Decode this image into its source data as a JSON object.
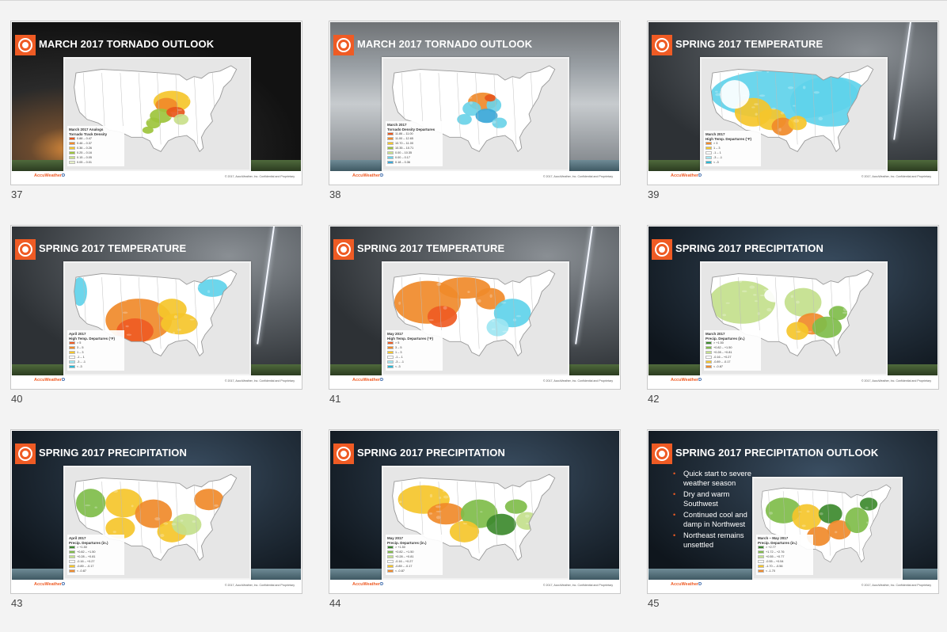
{
  "brand": {
    "name": "AccuWeather",
    "suffix": "D"
  },
  "slides": [
    {
      "number": "37",
      "title": "MARCH 2017 TORNADO OUTLOOK",
      "bg": "storm1",
      "sea": false,
      "mapStyle": "tornado-analog",
      "legend": {
        "title_lines": [
          "March 2017 Analogs",
          "Tornado Track Density"
        ],
        "rows": [
          [
            "#e8561b",
            "0.88 – 0.47"
          ],
          [
            "#f08a2a",
            "0.46 – 0.37"
          ],
          [
            "#f5c62b",
            "0.36 – 0.26"
          ],
          [
            "#9dc43c",
            "0.25 – 0.16"
          ],
          [
            "#c9df8a",
            "0.15 – 0.05"
          ],
          [
            "#e7f0c8",
            "0.05 – 0.01"
          ]
        ]
      },
      "copyright": "© 2017, AccuWeather, Inc. Confidential and Proprietary"
    },
    {
      "number": "38",
      "title": "MARCH 2017 TORNADO OUTLOOK",
      "bg": "storm2",
      "sea": true,
      "mapStyle": "tornado-departure",
      "legend": {
        "title_lines": [
          "March 2017",
          "Tornado Density Departures"
        ],
        "rows": [
          [
            "#e8561b",
            "11.86 – 11.00"
          ],
          [
            "#f08a2a",
            "11.00 – 12.65"
          ],
          [
            "#f5c62b",
            "10.70 – 11.00"
          ],
          [
            "#9dc43c",
            "10.35 – 10.71"
          ],
          [
            "#c9df8a",
            "0.00 – 10.35"
          ],
          [
            "#6ad2e8",
            "0.00 – 0.17"
          ],
          [
            "#3aa7d8",
            "0.18 – 0.36"
          ]
        ]
      },
      "copyright": "© 2017, AccuWeather, Inc. Confidential and Proprietary"
    },
    {
      "number": "39",
      "title": "SPRING 2017 TEMPERATURE",
      "bg": "storm3",
      "sea": false,
      "mapStyle": "temp-march",
      "legend": {
        "title_lines": [
          "March 2017",
          "High Temp. Departures (°F)"
        ],
        "rows": [
          [
            "#f08a2a",
            "> 3"
          ],
          [
            "#f5c62b",
            "1 – 3"
          ],
          [
            "#ffffff",
            "-1 – 1"
          ],
          [
            "#9ee6f2",
            "-3 – -1"
          ],
          [
            "#2bb7d4",
            "< -3"
          ]
        ]
      },
      "copyright": "© 2017, AccuWeather, Inc. Confidential and Proprietary"
    },
    {
      "number": "40",
      "title": "SPRING 2017 TEMPERATURE",
      "bg": "storm3",
      "sea": false,
      "mapStyle": "temp-april",
      "legend": {
        "title_lines": [
          "April 2017",
          "High Temp. Departures (°F)"
        ],
        "rows": [
          [
            "#ef5b24",
            "> 5"
          ],
          [
            "#f08a2a",
            "3 – 5"
          ],
          [
            "#f5c62b",
            "1 – 3"
          ],
          [
            "#ffffff",
            "-1 – 1"
          ],
          [
            "#9ee6f2",
            "-3 – -1"
          ],
          [
            "#2bb7d4",
            "< -3"
          ]
        ]
      },
      "copyright": "© 2017, AccuWeather, Inc. Confidential and Proprietary"
    },
    {
      "number": "41",
      "title": "SPRING 2017 TEMPERATURE",
      "bg": "storm3",
      "sea": false,
      "mapStyle": "temp-may",
      "legend": {
        "title_lines": [
          "May 2017",
          "High Temp. Departures (°F)"
        ],
        "rows": [
          [
            "#ef5b24",
            "> 5"
          ],
          [
            "#f08a2a",
            "3 – 5"
          ],
          [
            "#f5c62b",
            "1 – 3"
          ],
          [
            "#ffffff",
            "-1 – 1"
          ],
          [
            "#9ee6f2",
            "-3 – -1"
          ],
          [
            "#2bb7d4",
            "< -3"
          ]
        ]
      },
      "copyright": "© 2017, AccuWeather, Inc. Confidential and Proprietary"
    },
    {
      "number": "42",
      "title": "SPRING 2017 PRECIPITATION",
      "bg": "storm4",
      "sea": false,
      "mapStyle": "precip-march",
      "legend": {
        "title_lines": [
          "March 2017",
          "Precip. Departures (in.)"
        ],
        "rows": [
          [
            "#3d8a2e",
            "> +1.50"
          ],
          [
            "#7fbd4a",
            "+0.82 – +1.50"
          ],
          [
            "#c3e08c",
            "+0.28 – +0.81"
          ],
          [
            "#ffffff",
            "-0.16 – +0.27"
          ],
          [
            "#f5c62b",
            "-0.89 – -0.17"
          ],
          [
            "#f08a2a",
            "< -0.87"
          ]
        ]
      },
      "copyright": "© 2017, AccuWeather, Inc. Confidential and Proprietary"
    },
    {
      "number": "43",
      "title": "SPRING 2017 PRECIPITATION",
      "bg": "storm4",
      "sea": true,
      "mapStyle": "precip-april",
      "legend": {
        "title_lines": [
          "April 2017",
          "Precip. Departures (in.)"
        ],
        "rows": [
          [
            "#3d8a2e",
            "> +1.50"
          ],
          [
            "#7fbd4a",
            "+0.82 – +1.50"
          ],
          [
            "#c3e08c",
            "+0.28 – +0.81"
          ],
          [
            "#ffffff",
            "-0.16 – +0.27"
          ],
          [
            "#f5c62b",
            "-0.89 – -0.17"
          ],
          [
            "#f08a2a",
            "< -0.87"
          ]
        ]
      },
      "copyright": "© 2017, AccuWeather, Inc. Confidential and Proprietary"
    },
    {
      "number": "44",
      "title": "SPRING 2017 PRECIPITATION",
      "bg": "storm4",
      "sea": true,
      "mapStyle": "precip-may",
      "legend": {
        "title_lines": [
          "May 2017",
          "Precip. Departures (in.)"
        ],
        "rows": [
          [
            "#3d8a2e",
            "> +1.50"
          ],
          [
            "#7fbd4a",
            "+0.82 – +1.50"
          ],
          [
            "#c3e08c",
            "+0.28 – +0.81"
          ],
          [
            "#ffffff",
            "-0.16 – +0.27"
          ],
          [
            "#f5c62b",
            "-0.89 – -0.17"
          ],
          [
            "#f08a2a",
            "< -0.87"
          ]
        ]
      },
      "copyright": "© 2017, AccuWeather, Inc. Confidential and Proprietary"
    },
    {
      "number": "45",
      "title": "SPRING 2017 PRECIPITATION OUTLOOK",
      "bg": "storm4",
      "sea": true,
      "mapStyle": "precip-outlook",
      "bullets": [
        "Quick start to severe weather season",
        "Dry and warm Southwest",
        "Continued cool and damp in Northwest",
        "Northeast remains unsettled"
      ],
      "legend": {
        "title_lines": [
          "March – May 2017",
          "Precip. Departures (in.)"
        ],
        "rows": [
          [
            "#3d8a2e",
            "> +2.77"
          ],
          [
            "#7fbd4a",
            "+1.72 – +2.76"
          ],
          [
            "#c3e08c",
            "+0.55 – +0.77"
          ],
          [
            "#ffffff",
            "-0.55 – +0.54"
          ],
          [
            "#f5c62b",
            "-1.70 – -0.56"
          ],
          [
            "#f08a2a",
            "< -1.70"
          ]
        ]
      },
      "copyright": "© 2017, AccuWeather, Inc. Confidential and Proprietary"
    }
  ]
}
